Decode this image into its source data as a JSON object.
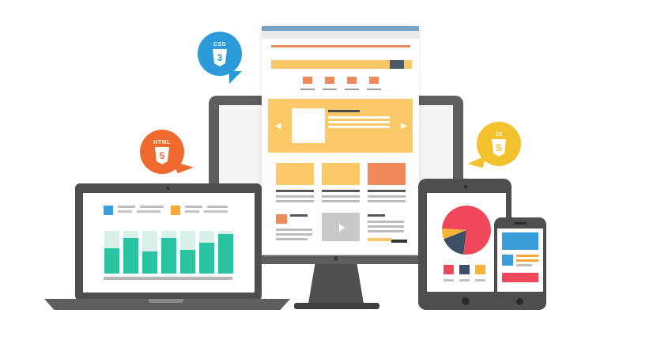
{
  "badges": {
    "css": {
      "label": "CSS",
      "glyph": "3",
      "color": "#2a9bd8",
      "icon": "css3-icon"
    },
    "html": {
      "label": "HTML",
      "glyph": "5",
      "color": "#ef6a2f",
      "icon": "html5-icon"
    },
    "js": {
      "label": "JS",
      "glyph": "S",
      "color": "#f2c12e",
      "icon": "js-icon"
    }
  },
  "colors": {
    "orange": "#f08a5b",
    "yellow": "#fbc868",
    "teal": "#2bc4a2",
    "pale_teal": "#d9efe9",
    "device_gray": "#4e4e50",
    "pie_red": "#f1475b",
    "pie_navy": "#3d4f66",
    "pie_yellow": "#f9b234",
    "blue": "#3a9ddc"
  },
  "laptop_chart": {
    "bars": [
      0.6,
      0.84,
      0.52,
      0.84,
      0.55,
      0.73,
      0.93
    ]
  },
  "tablet_pie": {
    "slices": [
      0.76,
      0.17,
      0.07
    ]
  }
}
